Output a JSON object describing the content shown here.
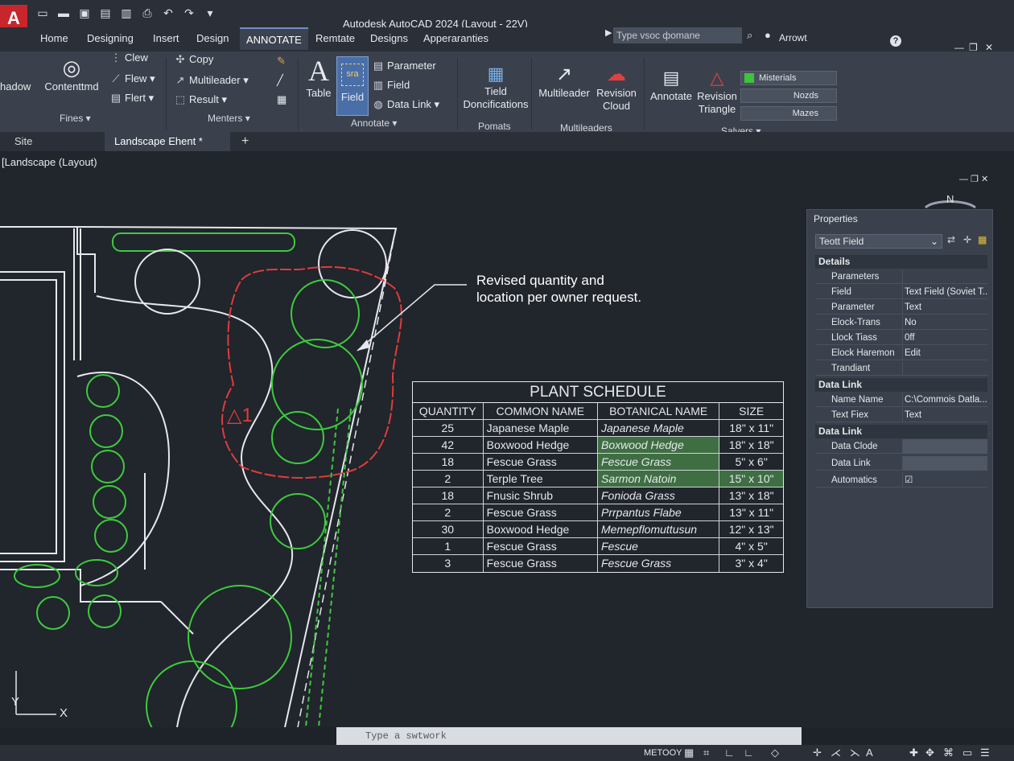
{
  "window": {
    "app_logo": "A",
    "title": "Autodesk AutoCAD 2024  (Layout - 22V)",
    "search_placeholder": "Type vsoc фomane",
    "user": "Arrowt",
    "help": "?"
  },
  "ribbon_tabs": [
    "Home",
    "Designing",
    "Insert",
    "Design",
    "ANNOTATE",
    "Remtate",
    "Designs",
    "Apperaranties"
  ],
  "active_tab": "ANNOTATE",
  "ribbon": {
    "shadow_label": "hadow",
    "contentmd": "Contenttmd",
    "clew": "Clew",
    "flew": "Flew",
    "flert": "Flert",
    "fines_panel": "Fines",
    "copy": "Copy",
    "multileader": "Multileader",
    "result": "Result",
    "menters_panel": "Menters",
    "text_glyph": "A",
    "table": "Table",
    "field_glyph": "sra",
    "field_big": "Field",
    "parameter": "Parameter",
    "field_small": "Field",
    "data_link": "Data Link",
    "annotate_panel": "Annotate",
    "tield_doncifications_1": "Tield",
    "tield_doncifications_2": "Doncifications",
    "pomats_panel": "Pomats",
    "multileader_big": "Multileader",
    "revision_cloud_1": "Revision",
    "revision_cloud_2": "Cloud",
    "multileaders_panel": "Multileaders",
    "annotate_big": "Annotate",
    "revision_triangle_1": "Revision",
    "revision_triangle_2": "Triangle",
    "salvers_panel": "Salvers",
    "layer_1": "Misterials",
    "layer_2": "Nozds",
    "layer_3": "Mazes"
  },
  "doc_tabs": [
    "Site",
    "Landscape Ehent *"
  ],
  "viewport_label": "[Landscape (Layout)",
  "callout": [
    "Revised quantity and",
    "location per owner request."
  ],
  "revision_tag": "△1",
  "compass": "N",
  "plant_schedule": {
    "title": "PLANT SCHEDULE",
    "headers": [
      "QUANTITY",
      "COMMON NAME",
      "BOTANICAL NAME",
      "SIZE"
    ],
    "rows": [
      [
        "25",
        "Japanese Maple",
        "Japanese Maple",
        "18\" x 11\""
      ],
      [
        "42",
        "Boxwood Hedge",
        "Boxwood Hedge",
        "18\" x 18\""
      ],
      [
        "18",
        "Fescue Grass",
        "Fescue Grass",
        "5\" x 6\""
      ],
      [
        "2",
        "Terple Tree",
        "Sarmon Natoin",
        "15\" x 10\""
      ],
      [
        "18",
        "Fnusic Shrub",
        "Fonioda Grass",
        "13\" x 18\""
      ],
      [
        "2",
        "Fescue Grass",
        "Prrpantus Flabe",
        "13\" x 11\""
      ],
      [
        "30",
        "Boxwood Hedge",
        "Memepflomuttusun",
        "12\" x 13\""
      ],
      [
        "1",
        "Fescue Grass",
        "Fescue",
        "4\" x 5\""
      ],
      [
        "3",
        "Fescue Grass",
        "Fescue Grass",
        "3\" x 4\""
      ]
    ]
  },
  "properties": {
    "title": "Properties",
    "selection": "Teott Field",
    "groups": [
      {
        "name": "Details",
        "rows": [
          [
            "Parameters",
            ""
          ],
          [
            "Field",
            "Text Field (Soviet T..."
          ],
          [
            "Parameter",
            "Text"
          ],
          [
            "Elock-Trans",
            "No"
          ],
          [
            "Llock Tiass",
            "0ff"
          ],
          [
            "Elock Haremon",
            "Edit"
          ],
          [
            "Trandiant",
            ""
          ]
        ]
      },
      {
        "name": "Data Link",
        "rows": [
          [
            "Name Name",
            "C:\\Commois Datla..."
          ],
          [
            "Text Fiex",
            "Text"
          ]
        ]
      },
      {
        "name": "Data Link",
        "rows": [
          [
            "Data Clode",
            ""
          ],
          [
            "Data Link",
            ""
          ],
          [
            "Automatics",
            "☑"
          ]
        ]
      }
    ]
  },
  "ucs": {
    "y": "Y",
    "x": "X"
  },
  "command_line": "Type a swtwork",
  "status_model": "METOOY"
}
